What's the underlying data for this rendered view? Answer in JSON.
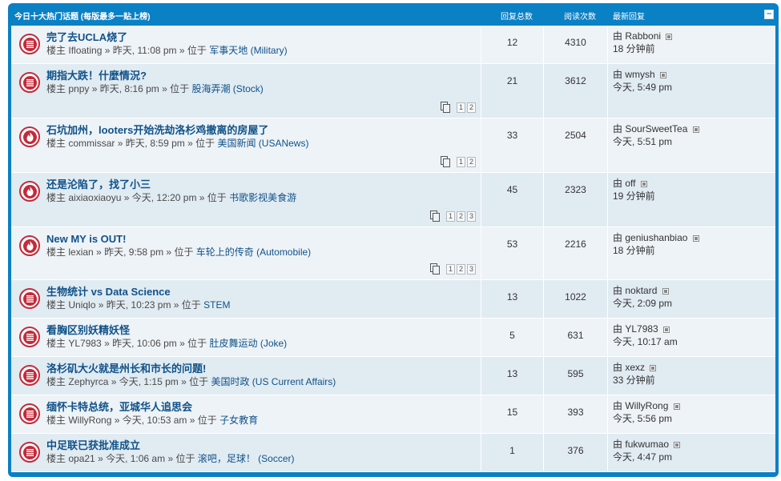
{
  "header": {
    "title": "今日十大热门话题",
    "subtitle": "(每版最多一贴上榜)",
    "col_replies": "回复总数",
    "col_views": "阅读次数",
    "col_last": "最新回复",
    "collapse": "–"
  },
  "labels": {
    "by": "由",
    "starter": "楼主",
    "in": "位于"
  },
  "topics": [
    {
      "title": "完了去UCLA烧了",
      "author": "Ifloating",
      "time": "昨天, 11:08 pm",
      "forum": "军事天地 (Military)",
      "replies": "12",
      "views": "4310",
      "last_user": "Rabboni",
      "last_time": "18 分钟前",
      "icon": "topic-read-icon",
      "pages": []
    },
    {
      "title": "期指大跌！什麼情況?",
      "author": "pnpy",
      "time": "昨天, 8:16 pm",
      "forum": "股海弄潮 (Stock)",
      "replies": "21",
      "views": "3612",
      "last_user": "wmysh",
      "last_time": "今天, 5:49 pm",
      "icon": "topic-read-icon",
      "pages": [
        "1",
        "2"
      ]
    },
    {
      "title": "石坑加州，looters开始洗劫洛杉鸡撤离的房屋了",
      "author": "commissar",
      "time": "昨天, 8:59 pm",
      "forum": "美国新闻 (USANews)",
      "replies": "33",
      "views": "2504",
      "last_user": "SourSweetTea",
      "last_time": "今天, 5:51 pm",
      "icon": "hot-topic-icon",
      "pages": [
        "1",
        "2"
      ]
    },
    {
      "title": "还是沦陷了，找了小三",
      "author": "aixiaoxiaoyu",
      "time": "今天, 12:20 pm",
      "forum": "书歌影视美食游",
      "replies": "45",
      "views": "2323",
      "last_user": "off",
      "last_time": "19 分钟前",
      "icon": "hot-topic-icon",
      "pages": [
        "1",
        "2",
        "3"
      ]
    },
    {
      "title": "New MY is OUT!",
      "author": "lexian",
      "time": "昨天, 9:58 pm",
      "forum": "车轮上的传奇 (Automobile)",
      "replies": "53",
      "views": "2216",
      "last_user": "geniushanbiao",
      "last_time": "18 分钟前",
      "icon": "hot-topic-icon",
      "pages": [
        "1",
        "2",
        "3"
      ]
    },
    {
      "title": "生物统计 vs Data Science",
      "author": "Uniqlo",
      "time": "昨天, 10:23 pm",
      "forum": "STEM",
      "replies": "13",
      "views": "1022",
      "last_user": "noktard",
      "last_time": "今天, 2:09 pm",
      "icon": "topic-read-icon",
      "pages": []
    },
    {
      "title": "看胸区别妖精妖怪",
      "author": "YL7983",
      "time": "昨天, 10:06 pm",
      "forum": "肚皮舞运动 (Joke)",
      "replies": "5",
      "views": "631",
      "last_user": "YL7983",
      "last_time": "今天, 10:17 am",
      "icon": "topic-read-icon",
      "pages": []
    },
    {
      "title": "洛杉矶大火就是州长和市长的问题!",
      "author": "Zephyrca",
      "time": "今天, 1:15 pm",
      "forum": "美国时政 (US Current Affairs)",
      "replies": "13",
      "views": "595",
      "last_user": "xexz",
      "last_time": "33 分钟前",
      "icon": "topic-read-icon",
      "pages": []
    },
    {
      "title": "缅怀卡特总统，亚城华人追思会",
      "author": "WillyRong",
      "time": "今天, 10:53 am",
      "forum": "子女教育",
      "replies": "15",
      "views": "393",
      "last_user": "WillyRong",
      "last_time": "今天, 5:56 pm",
      "icon": "topic-read-icon",
      "pages": []
    },
    {
      "title": "中足联已获批准成立",
      "author": "opa21",
      "time": "今天, 1:06 am",
      "forum": "滚吧，足球！ (Soccer)",
      "replies": "1",
      "views": "376",
      "last_user": "fukwumao",
      "last_time": "今天, 4:47 pm",
      "icon": "topic-read-icon",
      "pages": []
    }
  ],
  "colors": {
    "frame": "#0a80c5",
    "title_link": "#105289",
    "icon_red": "#c42a3a",
    "row_a": "#eef3f7",
    "row_b": "#e1ebf2"
  }
}
